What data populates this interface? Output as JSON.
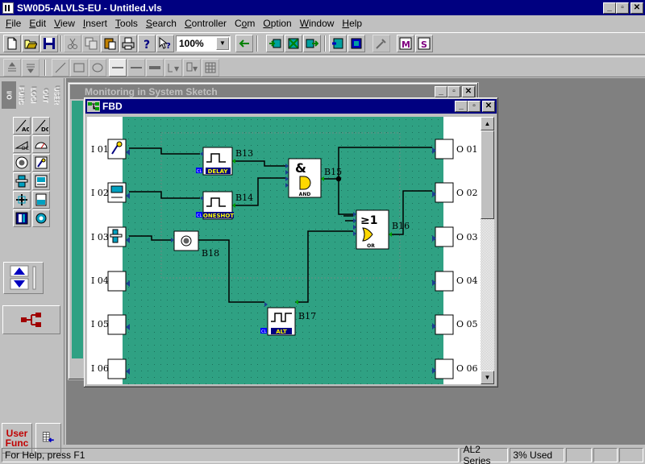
{
  "window": {
    "title": "SW0D5-ALVLS-EU - Untitled.vls",
    "controls": {
      "minimize": "_",
      "maximize": "▫",
      "close": "✕"
    }
  },
  "menu": [
    {
      "label": "File",
      "key": "F"
    },
    {
      "label": "Edit",
      "key": "E"
    },
    {
      "label": "View",
      "key": "V"
    },
    {
      "label": "Insert",
      "key": "I"
    },
    {
      "label": "Tools",
      "key": "T"
    },
    {
      "label": "Search",
      "key": "S"
    },
    {
      "label": "Controller",
      "key": "C"
    },
    {
      "label": "Com",
      "key": "o"
    },
    {
      "label": "Option",
      "key": "O"
    },
    {
      "label": "Window",
      "key": "W"
    },
    {
      "label": "Help",
      "key": "H"
    }
  ],
  "toolbar": {
    "zoom_value": "100%"
  },
  "palette": {
    "tabs": [
      "I/O",
      "FUNC",
      "LOGI",
      "OUT",
      "USER"
    ],
    "user_func_line1": "User",
    "user_func_line2": "Func"
  },
  "windows": {
    "system_sketch_title": "Monitoring in System Sketch",
    "fbd_title": "FBD"
  },
  "fbd": {
    "inputs": [
      "I 01",
      "I 02",
      "I 03",
      "I 04",
      "I 05",
      "I 06"
    ],
    "outputs": [
      "O 01",
      "O 02",
      "O 03",
      "O 04",
      "O 05",
      "O 06"
    ],
    "blocks": [
      {
        "id": "B13",
        "label": "DELAY",
        "pin": "CL"
      },
      {
        "id": "B14",
        "label": "ONESHOT",
        "pin": "CL"
      },
      {
        "id": "B15",
        "label": "AND",
        "symbol": "&"
      },
      {
        "id": "B16",
        "label": "OR",
        "symbol": "≥1"
      },
      {
        "id": "B17",
        "label": "ALT",
        "pin": "CL"
      },
      {
        "id": "B18",
        "label": ""
      }
    ],
    "colors": {
      "background": "#2fa183",
      "dots": "#1b6f5a",
      "wire": "#000000",
      "block_label": "#ffff00"
    }
  },
  "status": {
    "help": "For Help, press F1",
    "series": "AL2 Series",
    "used": "3% Used"
  }
}
